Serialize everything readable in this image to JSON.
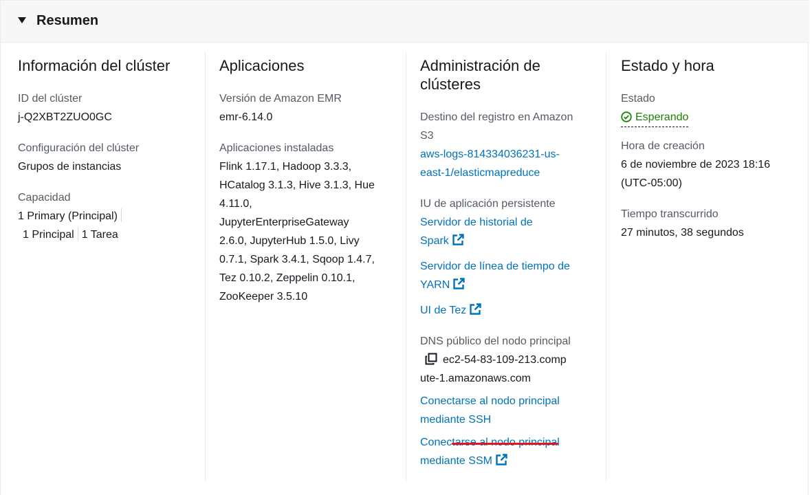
{
  "header": {
    "title": "Resumen"
  },
  "cluster_info": {
    "title": "Información del clúster",
    "id_label": "ID del clúster",
    "id_value": "j-Q2XBT2ZUO0GC",
    "config_label": "Configuración del clúster",
    "config_value": "Grupos de instancias",
    "capacity_label": "Capacidad",
    "capacity_primary": "1 Primary (Principal)",
    "capacity_principal": "1 Principal",
    "capacity_task": "1 Tarea"
  },
  "applications": {
    "title": "Aplicaciones",
    "version_label": "Versión de Amazon EMR",
    "version_value": "emr-6.14.0",
    "installed_label": "Aplicaciones instaladas",
    "installed_lines": [
      "Flink 1.17.1, Hadoop 3.3.3,",
      "HCatalog 3.1.3, Hive 3.1.3, Hue",
      "4.11.0,",
      "JupyterEnterpriseGateway",
      "2.6.0, JupyterHub 1.5.0, Livy",
      "0.7.1, Spark 3.4.1, Sqoop 1.4.7,",
      "Tez 0.10.2, Zeppelin 0.10.1,",
      "ZooKeeper 3.5.10"
    ]
  },
  "cluster_admin": {
    "title_line1": "Administración de",
    "title_line2": "clústeres",
    "log_label_line1": "Destino del registro en Amazon",
    "log_label_line2": "S3",
    "log_link_line1": "aws-logs-814334036231-us-",
    "log_link_line2": "east-1/elasticmapreduce",
    "ui_label": "IU de aplicación persistente",
    "spark_line1": "Servidor de historial de",
    "spark_line2": "Spark",
    "yarn_line1": "Servidor de línea de tiempo de",
    "yarn_line2": "YARN",
    "tez": "UI de Tez",
    "dns_label": "DNS público del nodo principal",
    "dns_line1": "ec2-54-83-109-213.comp",
    "dns_line2": "ute-1.amazonaws.com",
    "ssh_line1": "Conectarse al nodo principal",
    "ssh_line2": "mediante SSH",
    "ssm_line1": "Conectarse al nodo principal",
    "ssm_line2": "mediante SSM"
  },
  "status_time": {
    "title": "Estado y hora",
    "status_label": "Estado",
    "status_value": "Esperando",
    "created_label": "Hora de creación",
    "created_line1": "6 de noviembre de 2023 18:16",
    "created_line2": "(UTC-05:00)",
    "elapsed_label": "Tiempo transcurrido",
    "elapsed_value": "27 minutos, 38 segundos"
  },
  "colors": {
    "link": "#0073bb",
    "success": "#1d8102",
    "annotation": "#e8141c"
  },
  "icons": [
    "caret-down-icon",
    "external-link-icon",
    "check-circle-icon",
    "copy-icon"
  ]
}
